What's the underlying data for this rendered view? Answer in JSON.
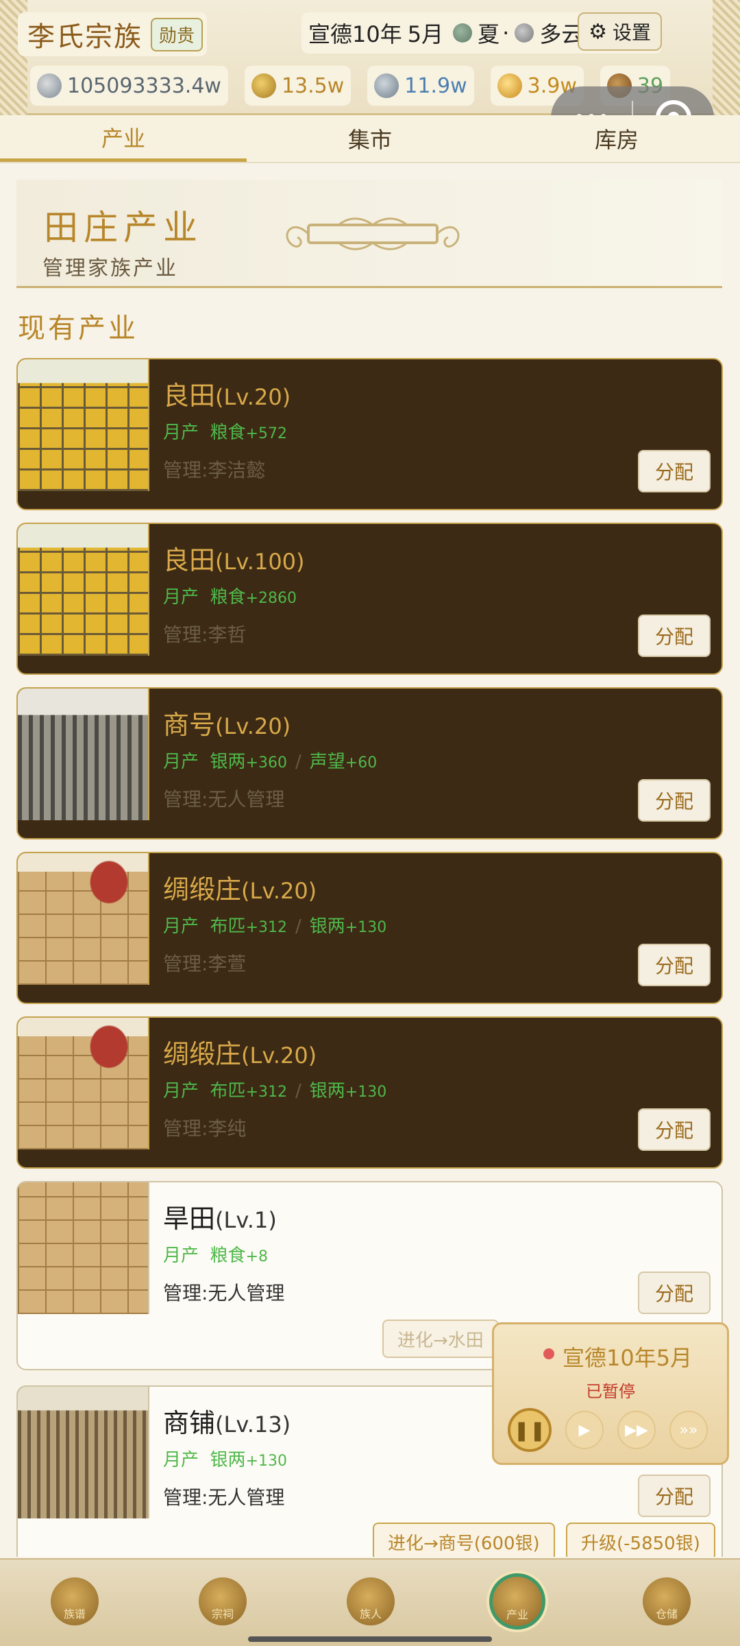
{
  "header": {
    "clan_name": "李氏宗族",
    "badge": "勋贵",
    "era": "宣德",
    "year": "10年",
    "month": "5月",
    "season": "夏",
    "weather": "多云",
    "settings_label": "设置",
    "resources": [
      {
        "icon": "silver-coin-icon",
        "value": "105093333.4w",
        "color": "#5a6670"
      },
      {
        "icon": "money-bag-icon",
        "value": "13.5w",
        "color": "#b8862a"
      },
      {
        "icon": "scroll-icon",
        "value": "11.9w",
        "color": "#4b7fb0"
      },
      {
        "icon": "prestige-icon",
        "value": "3.9w",
        "color": "#c48a1c"
      },
      {
        "icon": "people-icon",
        "value": "39",
        "color": "#5da15a"
      }
    ]
  },
  "tabs": [
    {
      "label": "产业",
      "active": true
    },
    {
      "label": "集市",
      "active": false
    },
    {
      "label": "库房",
      "active": false
    }
  ],
  "banner": {
    "title": "田庄产业",
    "subtitle": "管理家族产业"
  },
  "section_title": "现有产业",
  "assign_label": "分配",
  "properties": [
    {
      "name": "良田",
      "level": "(Lv.20)",
      "yield_prefix": "月产",
      "yields": [
        {
          "name": "粮食",
          "amount": "+572"
        }
      ],
      "manager": "管理:李洁懿",
      "thumb": "field",
      "style": "dark"
    },
    {
      "name": "良田",
      "level": "(Lv.100)",
      "yield_prefix": "月产",
      "yields": [
        {
          "name": "粮食",
          "amount": "+2860"
        }
      ],
      "manager": "管理:李哲",
      "thumb": "field",
      "style": "dark"
    },
    {
      "name": "商号",
      "level": "(Lv.20)",
      "yield_prefix": "月产",
      "yields": [
        {
          "name": "银两",
          "amount": "+360"
        },
        {
          "name": "声望",
          "amount": "+60"
        }
      ],
      "manager": "管理:无人管理",
      "thumb": "town",
      "style": "dark"
    },
    {
      "name": "绸缎庄",
      "level": "(Lv.20)",
      "yield_prefix": "月产",
      "yields": [
        {
          "name": "布匹",
          "amount": "+312"
        },
        {
          "name": "银两",
          "amount": "+130"
        }
      ],
      "manager": "管理:李萱",
      "thumb": "silk",
      "style": "dark"
    },
    {
      "name": "绸缎庄",
      "level": "(Lv.20)",
      "yield_prefix": "月产",
      "yields": [
        {
          "name": "布匹",
          "amount": "+312"
        },
        {
          "name": "银两",
          "amount": "+130"
        }
      ],
      "manager": "管理:李纯",
      "thumb": "silk",
      "style": "dark"
    },
    {
      "name": "旱田",
      "level": "(Lv.1)",
      "yield_prefix": "月产",
      "yields": [
        {
          "name": "粮食",
          "amount": "+8"
        }
      ],
      "manager": "管理:无人管理",
      "thumb": "dry",
      "style": "light",
      "evolve": "进化→水田"
    },
    {
      "name": "商铺",
      "level": "(Lv.13)",
      "yield_prefix": "月产",
      "yields": [
        {
          "name": "银两",
          "amount": "+130"
        }
      ],
      "manager": "管理:无人管理",
      "thumb": "street",
      "style": "light",
      "evolve": "进化→商号(600银)",
      "upgrade": "升级(-5850银)"
    }
  ],
  "time_widget": {
    "title": "宣德10年5月",
    "state": "已暂停"
  },
  "bottom_nav": [
    {
      "icon": "book-icon",
      "label": "族谱"
    },
    {
      "icon": "palace-icon",
      "label": "宗祠"
    },
    {
      "icon": "people-icon",
      "label": "族人"
    },
    {
      "icon": "property-icon",
      "label": "产业",
      "active": true
    },
    {
      "icon": "warehouse-icon",
      "label": "仓储"
    }
  ]
}
